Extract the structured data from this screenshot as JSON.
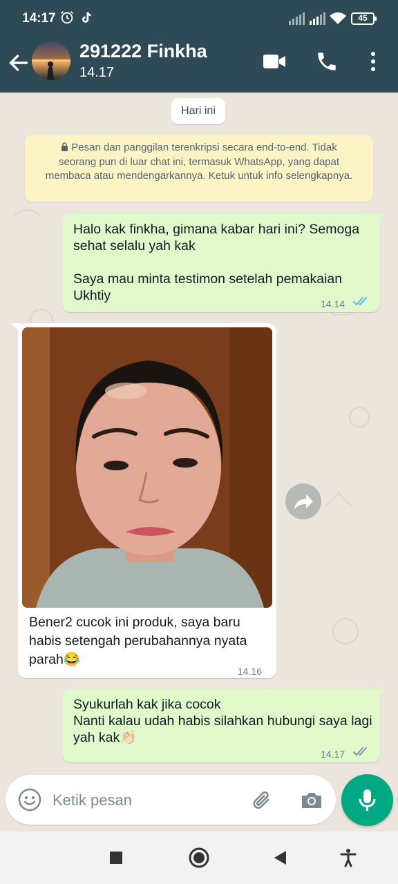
{
  "status_bar": {
    "time": "14:17",
    "battery": "45",
    "icons": [
      "alarm-icon",
      "tiktok-icon",
      "signal-icon",
      "signal-icon",
      "wifi-icon",
      "battery-icon"
    ]
  },
  "header": {
    "contact_name": "291222 Finkha",
    "subtitle": "14.17",
    "icons": [
      "back-arrow-icon",
      "video-call-icon",
      "phone-icon",
      "more-vertical-icon"
    ],
    "bar_color": "#2e4a56"
  },
  "chat": {
    "date_chip": "Hari ini",
    "encryption_notice": "Pesan dan panggilan terenkripsi secara end-to-end. Tidak seorang pun di luar chat ini, termasuk WhatsApp, yang dapat membaca atau mendengarkannya. Ketuk untuk info selengkapnya.",
    "messages": [
      {
        "direction": "outgoing",
        "text": "Halo kak finkha, gimana kabar hari ini? Semoga sehat selalu yah kak\n\nSaya mau minta testimon setelah pemakaian Ukhtiy",
        "time": "14.14",
        "status": "read"
      },
      {
        "direction": "incoming",
        "has_image": true,
        "text": "Bener2 cucok ini produk, saya baru habis setengah perubahannya nyata parah😂",
        "time": "14.16"
      },
      {
        "direction": "outgoing",
        "text": "Syukurlah kak jika cocok\nNanti kalau udah habis silahkan hubungi saya lagi yah kak👏🏻",
        "time": "14.17",
        "status": "delivered"
      }
    ],
    "colors": {
      "outgoing": "#e1f8cb",
      "incoming": "#ffffff",
      "read_ticks": "#53bdeb",
      "background": "#ece5dd"
    }
  },
  "composer": {
    "placeholder": "Ketik pesan",
    "icons": [
      "emoji-icon",
      "paperclip-icon",
      "camera-icon",
      "microphone-icon"
    ],
    "accent": "#00a884"
  },
  "nav_bar": {
    "icons": [
      "recents-square-icon",
      "home-circle-icon",
      "back-triangle-icon",
      "accessibility-icon"
    ]
  }
}
